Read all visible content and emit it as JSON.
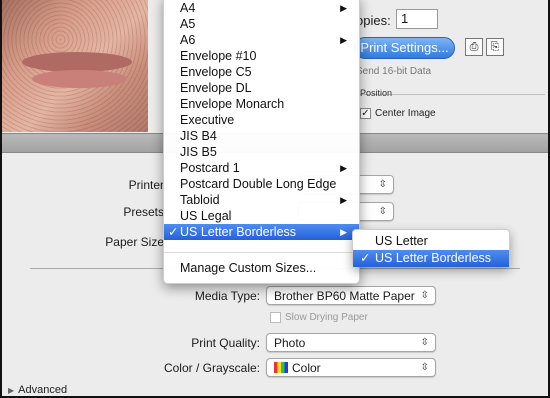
{
  "top": {
    "copies_label": "opies:",
    "copies_value": "1",
    "print_settings_label": "Print Settings...",
    "send16_label": "Send 16-bit Data",
    "position_legend": "Position",
    "center_image_label": "Center Image"
  },
  "form": {
    "printer_label": "Printer",
    "presets_label": "Presets",
    "paper_size_label": "Paper Size",
    "paper_size_value": "US Letter Borderless",
    "media_type_label": "Media Type:",
    "media_type_value": "Brother BP60 Matte Paper",
    "slow_drying_label": "Slow Drying Paper",
    "print_quality_label": "Print Quality:",
    "print_quality_value": "Photo",
    "color_label": "Color / Grayscale:",
    "color_value": "Color",
    "advanced_label": "Advanced"
  },
  "menu": {
    "items": [
      {
        "label": "A4",
        "submenu": true
      },
      {
        "label": "A5",
        "submenu": false
      },
      {
        "label": "A6",
        "submenu": true
      },
      {
        "label": "Envelope #10",
        "submenu": false
      },
      {
        "label": "Envelope C5",
        "submenu": false
      },
      {
        "label": "Envelope DL",
        "submenu": false
      },
      {
        "label": "Envelope Monarch",
        "submenu": false
      },
      {
        "label": "Executive",
        "submenu": false
      },
      {
        "label": "JIS B4",
        "submenu": false
      },
      {
        "label": "JIS B5",
        "submenu": false
      },
      {
        "label": "Postcard 1",
        "submenu": true
      },
      {
        "label": "Postcard Double Long Edge",
        "submenu": false
      },
      {
        "label": "Tabloid",
        "submenu": true
      },
      {
        "label": "US Legal",
        "submenu": false
      },
      {
        "label": "US Letter Borderless",
        "submenu": true,
        "selected": true
      }
    ],
    "manage_label": "Manage Custom Sizes..."
  },
  "submenu": {
    "items": [
      {
        "label": "US Letter",
        "selected": false
      },
      {
        "label": "US Letter Borderless",
        "selected": true
      }
    ]
  },
  "glyphs": {
    "check": "✓",
    "submenu_arrow": "▶",
    "popup_arrows": "⌃⌄",
    "disclosure": "▶"
  },
  "colors": {
    "selection_top": "#4f8cf0",
    "selection_bottom": "#2461db",
    "button_blue": "#2f7be0"
  }
}
